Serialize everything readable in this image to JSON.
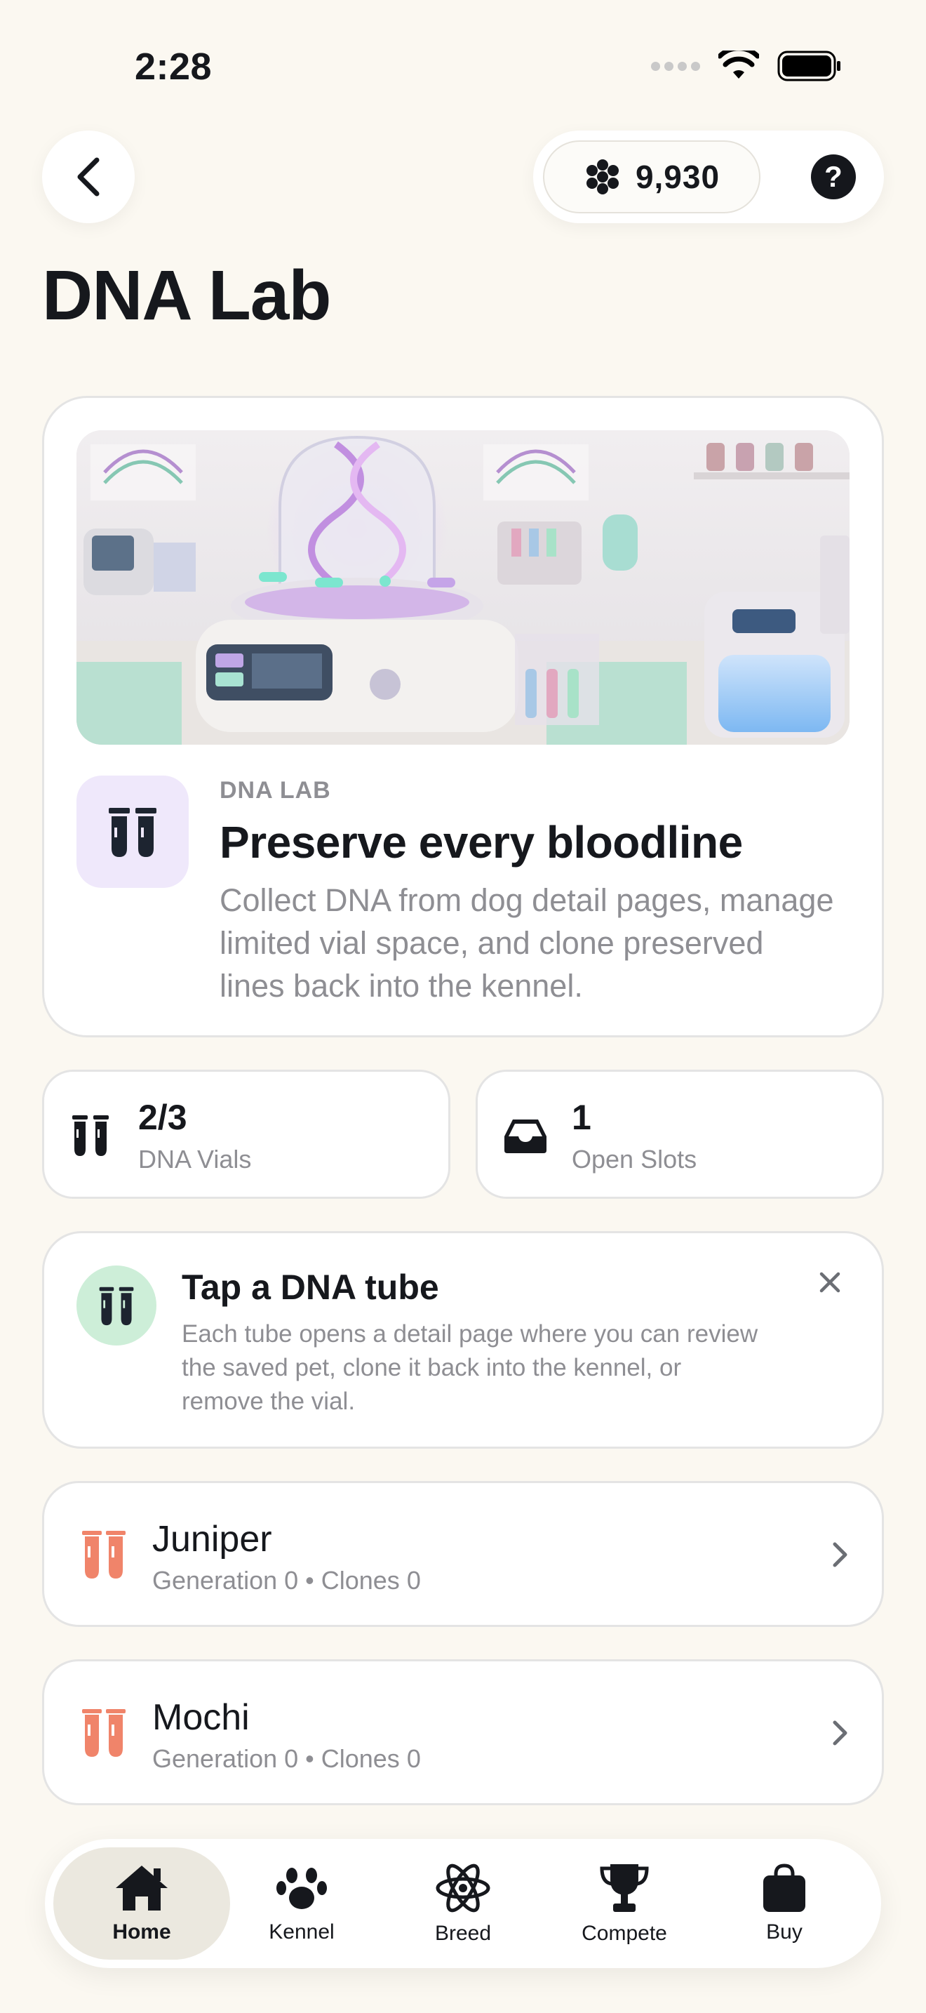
{
  "status_bar": {
    "time": "2:28"
  },
  "top_bar": {
    "currency_value": "9,930",
    "help_label": "?"
  },
  "page_title": "DNA Lab",
  "hero": {
    "eyebrow": "DNA LAB",
    "title": "Preserve every bloodline",
    "description": "Collect DNA from dog detail pages, manage limited vial space, and clone preserved lines back into the kennel."
  },
  "stats": [
    {
      "value": "2/3",
      "label": "DNA Vials",
      "icon": "test-tubes-icon"
    },
    {
      "value": "1",
      "label": "Open Slots",
      "icon": "inbox-tray-icon"
    }
  ],
  "tip": {
    "title": "Tap a DNA tube",
    "description": "Each tube opens a detail page where you can review the saved pet, clone it back into the kennel, or remove the vial."
  },
  "dna_list": [
    {
      "name": "Juniper",
      "meta": "Generation 0 • Clones 0"
    },
    {
      "name": "Mochi",
      "meta": "Generation 0 • Clones 0"
    }
  ],
  "tabs": [
    {
      "label": "Home",
      "icon": "house-icon",
      "active": true
    },
    {
      "label": "Kennel",
      "icon": "paw-icon",
      "active": false
    },
    {
      "label": "Breed",
      "icon": "atom-icon",
      "active": false
    },
    {
      "label": "Compete",
      "icon": "trophy-icon",
      "active": false
    },
    {
      "label": "Buy",
      "icon": "shopping-bag-icon",
      "active": false
    }
  ],
  "colors": {
    "background": "#fbf8f1",
    "hero_icon_bg": "#efe8fb",
    "tip_icon_bg": "#cdeed8",
    "vial_orange": "#f0846a",
    "active_tab_bg": "#ebe8df"
  }
}
